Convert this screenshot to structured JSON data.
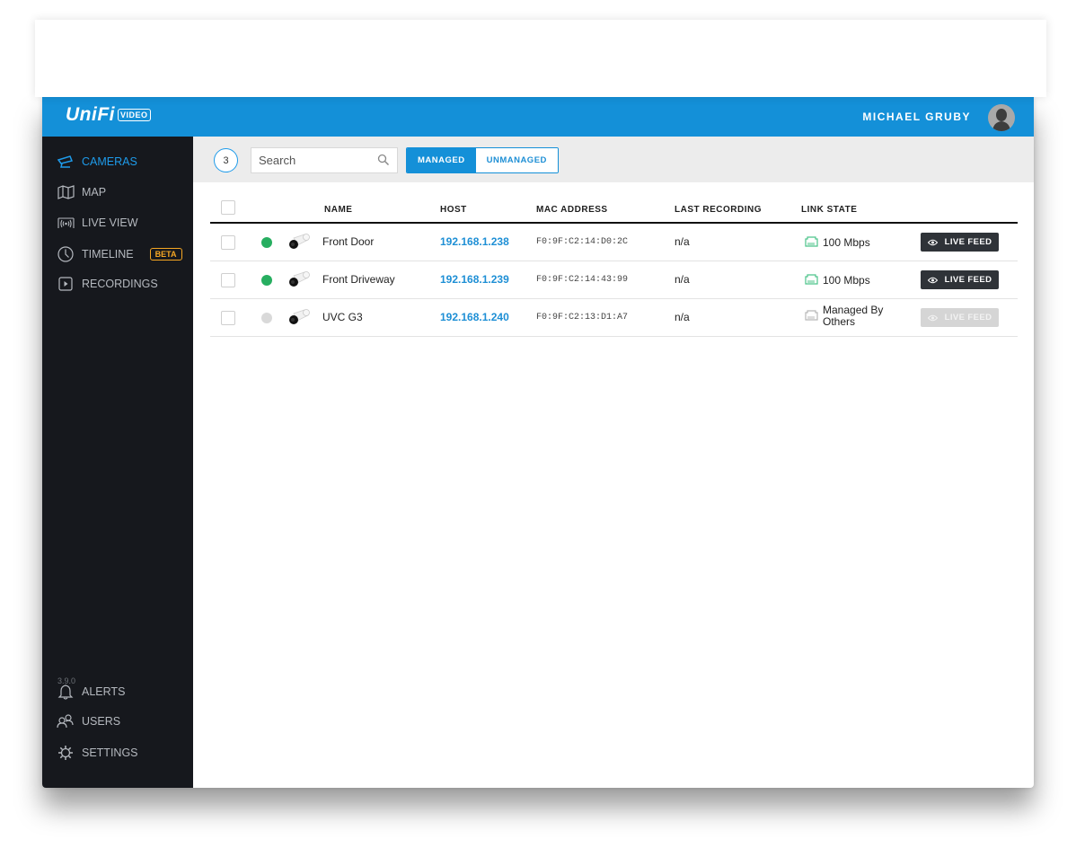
{
  "app": {
    "logo_text": "UniFi",
    "logo_badge": "VIDEO",
    "user_name": "MICHAEL GRUBY",
    "version": "3.9.0",
    "accent_color": "#1490d8"
  },
  "sidebar": {
    "items": [
      {
        "label": "CAMERAS",
        "icon": "camera-icon",
        "active": true
      },
      {
        "label": "MAP",
        "icon": "map-icon"
      },
      {
        "label": "LIVE VIEW",
        "icon": "live-view-icon"
      },
      {
        "label": "TIMELINE",
        "icon": "clock-icon",
        "badge": "BETA"
      },
      {
        "label": "RECORDINGS",
        "icon": "play-icon"
      }
    ],
    "bottom_items": [
      {
        "label": "ALERTS",
        "icon": "bell-icon"
      },
      {
        "label": "USERS",
        "icon": "users-icon"
      },
      {
        "label": "SETTINGS",
        "icon": "gear-icon"
      }
    ]
  },
  "toolbar": {
    "count": "3",
    "search_placeholder": "Search",
    "search_value": "",
    "tabs": [
      {
        "label": "MANAGED",
        "selected": true
      },
      {
        "label": "UNMANAGED",
        "selected": false
      }
    ]
  },
  "table": {
    "columns": [
      "NAME",
      "HOST",
      "MAC ADDRESS",
      "LAST RECORDING",
      "LINK STATE"
    ],
    "rows": [
      {
        "status": "online",
        "status_color": "#27ae60",
        "name": "Front Door",
        "host": "192.168.1.238",
        "mac": "F0:9F:C2:14:D0:2C",
        "last_recording": "n/a",
        "link_state": "100 Mbps",
        "link_color": "#4cc38a",
        "action": "LIVE FEED",
        "action_enabled": true
      },
      {
        "status": "online",
        "status_color": "#27ae60",
        "name": "Front Driveway",
        "host": "192.168.1.239",
        "mac": "F0:9F:C2:14:43:99",
        "last_recording": "n/a",
        "link_state": "100 Mbps",
        "link_color": "#4cc38a",
        "action": "LIVE FEED",
        "action_enabled": true
      },
      {
        "status": "managed-by-others",
        "status_color": "#d9d9d9",
        "name": "UVC G3",
        "host": "192.168.1.240",
        "mac": "F0:9F:C2:13:D1:A7",
        "last_recording": "n/a",
        "link_state": "Managed By Others",
        "link_color": "#b8b8b8",
        "action": "LIVE FEED",
        "action_enabled": false
      }
    ]
  }
}
